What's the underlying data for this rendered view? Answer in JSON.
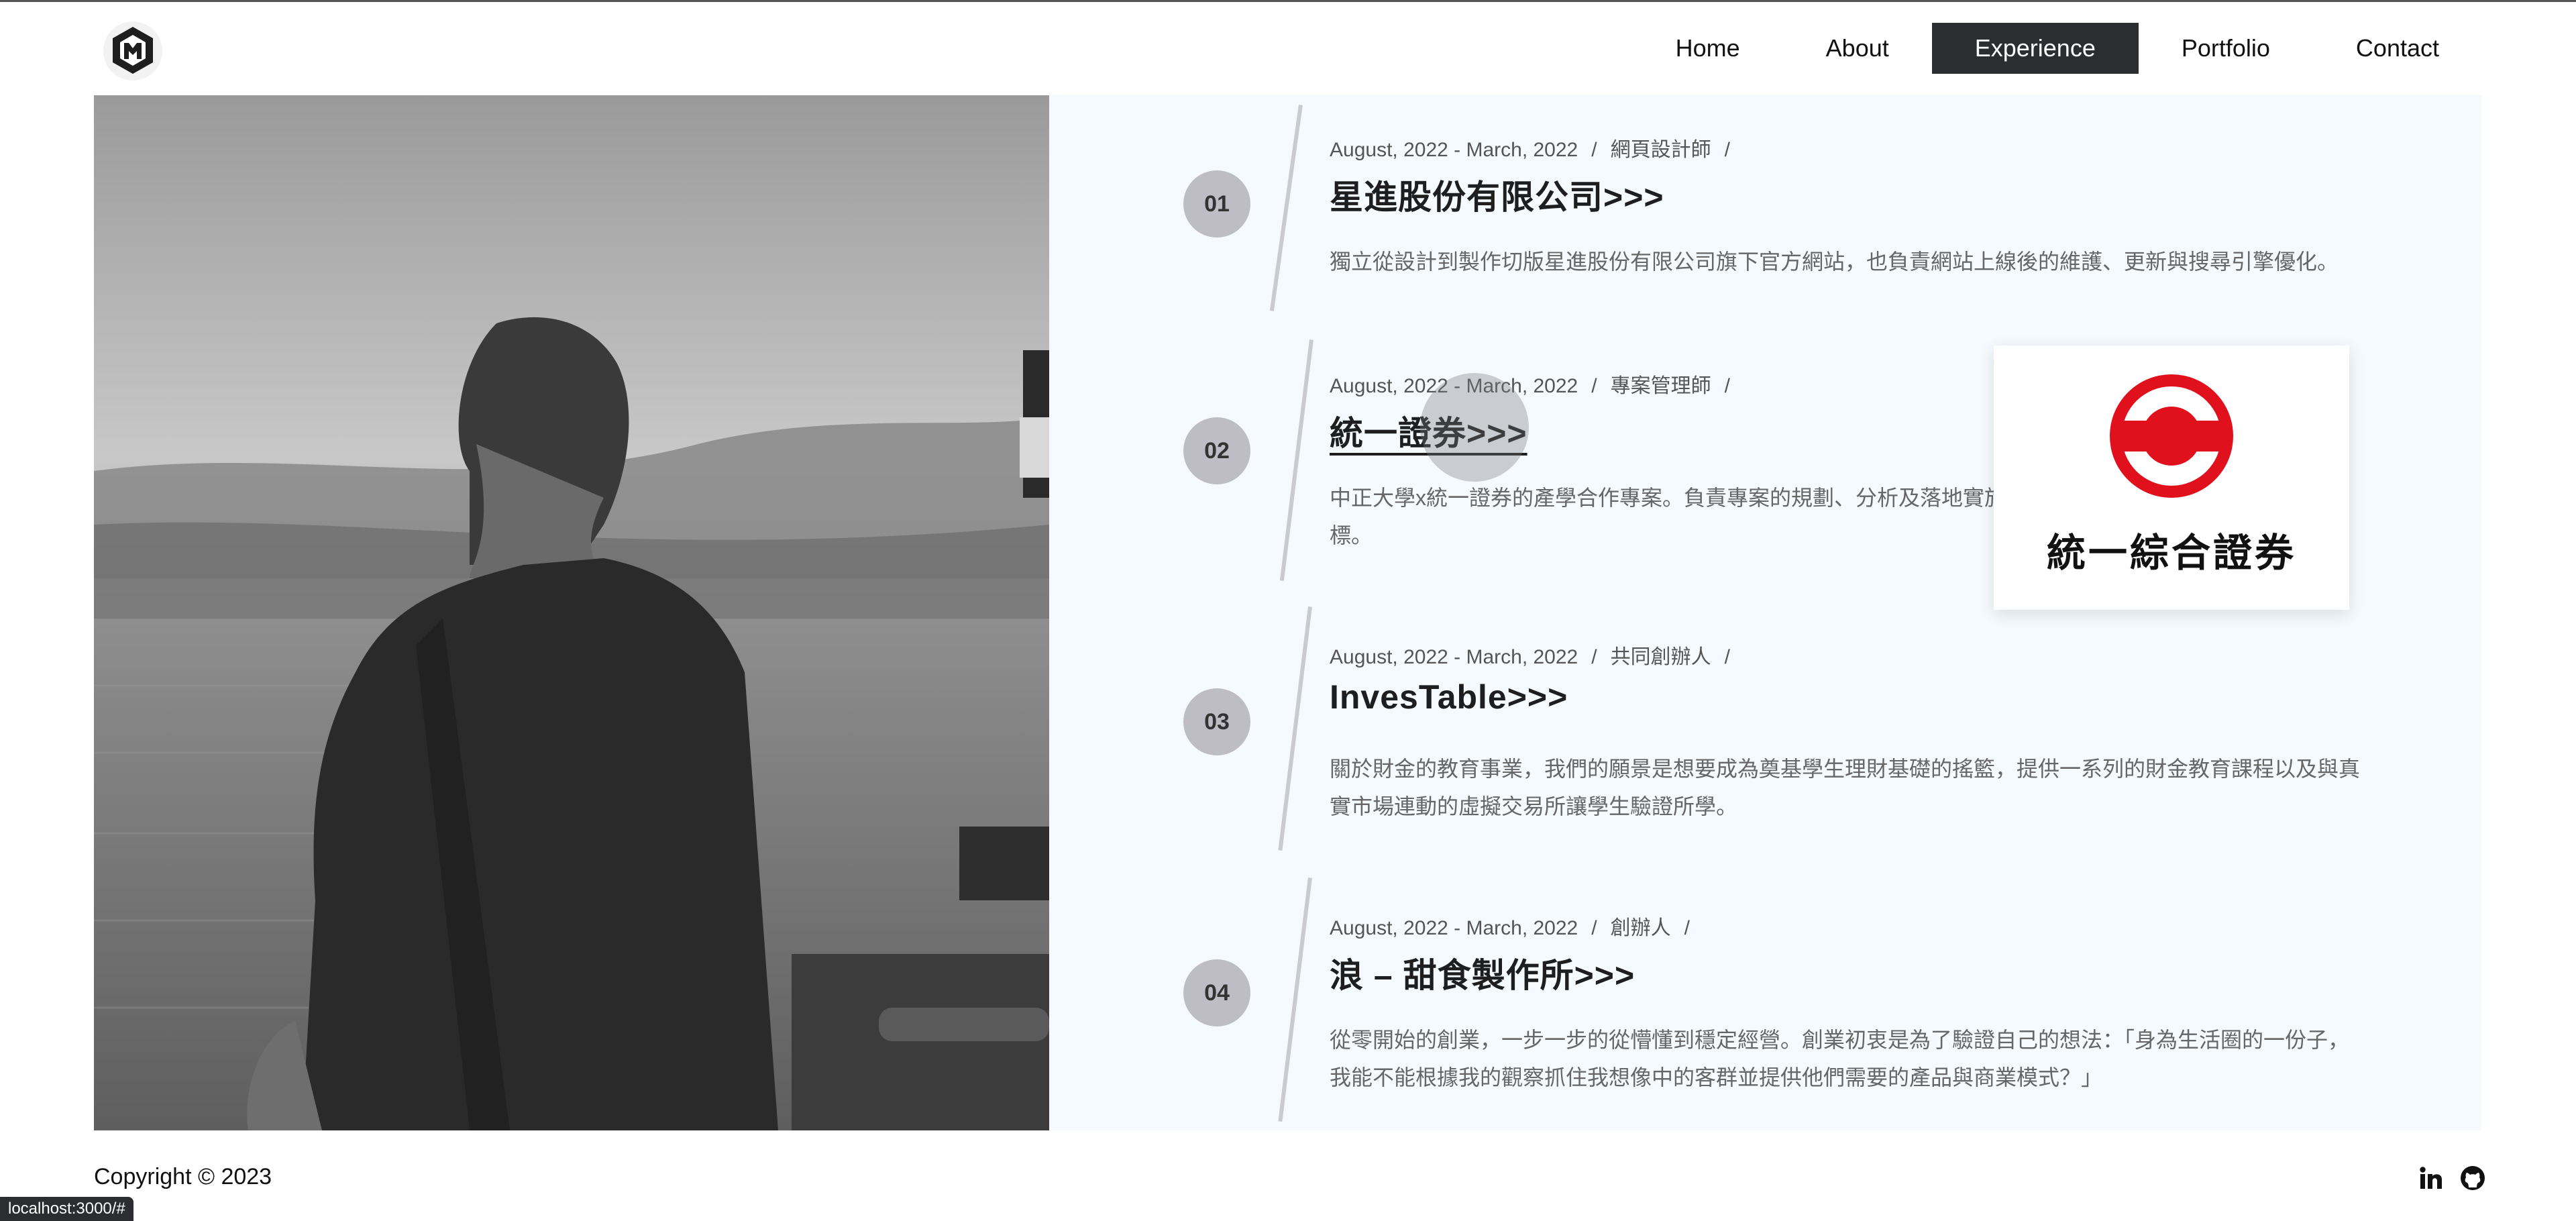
{
  "nav": {
    "items": [
      {
        "label": "Home"
      },
      {
        "label": "About"
      },
      {
        "label": "Experience"
      },
      {
        "label": "Portfolio"
      },
      {
        "label": "Contact"
      }
    ],
    "active": "Experience"
  },
  "experience": [
    {
      "num": "01",
      "date": "August, 2022 - March, 2022",
      "role": "網頁設計師",
      "title": "星進股份有限公司>>>",
      "desc": "獨立從設計到製作切版星進股份有限公司旗下官方網站，也負責網站上線後的維護、更新與搜尋引擎優化。"
    },
    {
      "num": "02",
      "date": "August, 2022 - March, 2022",
      "role": "專案管理師",
      "title": "統一證券>>>",
      "desc": "中正大學x統一證券的產學合作專案。負責專案的規劃、分析及落地實施。達成統一證券深耕大學生客群的目標。"
    },
    {
      "num": "03",
      "date": "August, 2022 - March, 2022",
      "role": "共同創辦人",
      "title": "InvesTable>>>",
      "desc": "關於財金的教育事業，我們的願景是想要成為奠基學生理財基礎的搖籃，提供一系列的財金教育課程以及與真實市場連動的虛擬交易所讓學生驗證所學。"
    },
    {
      "num": "04",
      "date": "August, 2022 - March, 2022",
      "role": "創辦人",
      "title": "浪 – 甜食製作所>>>",
      "desc": "從零開始的創業，一步一步的從懵懂到穩定經營。創業初衷是為了驗證自己的想法：「身為生活圈的一份子，我能不能根據我的觀察抓住我想像中的客群並提供他們需要的產品與商業模式？」"
    }
  ],
  "preview": {
    "brand_text": "統一綜合證券"
  },
  "footer": {
    "copyright": "Copyright © 2023"
  },
  "status_bar": {
    "url": "localhost:3000/#"
  },
  "colors": {
    "nav_active_bg": "#2b2d31",
    "panel_bg": "#f4fafd",
    "badge_bg": "#bebcc4",
    "brand_red": "#e0101c"
  }
}
